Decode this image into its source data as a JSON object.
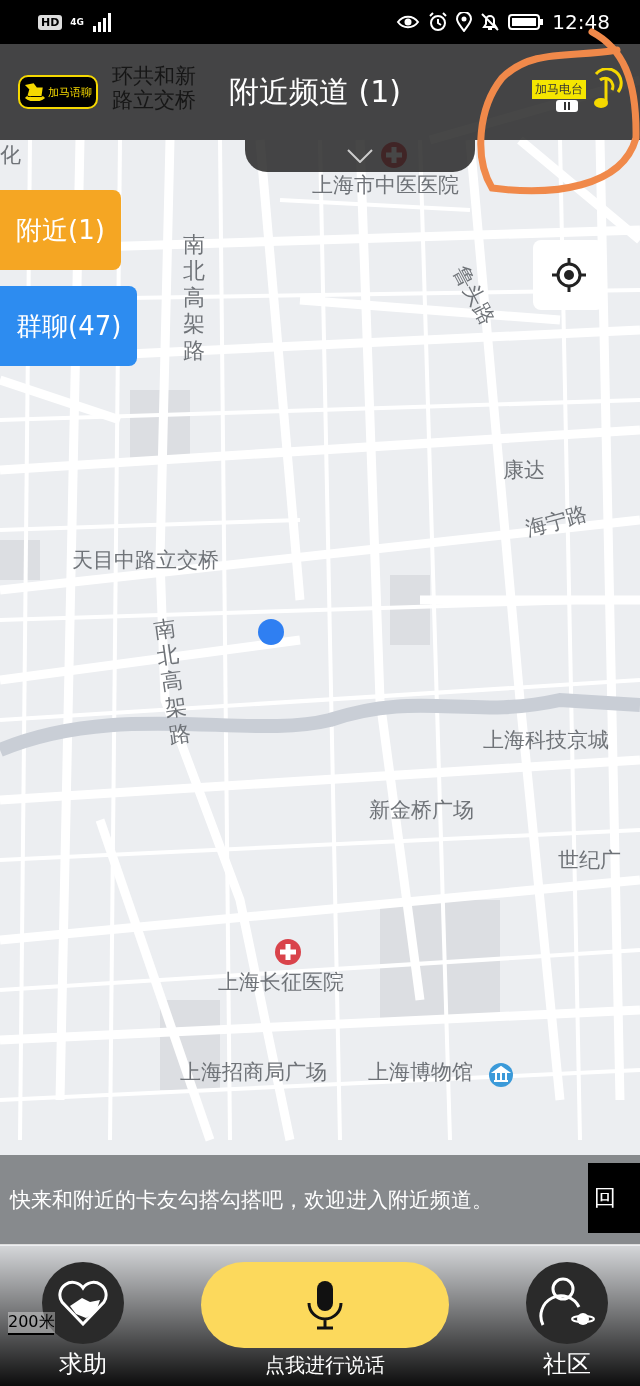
{
  "status_bar": {
    "network": "HD",
    "signal_label": "4G",
    "time": "12:48"
  },
  "header": {
    "logo_text": "加马语聊",
    "title": "附近频道 (1)",
    "radio": {
      "label": "加马电台",
      "playing": true
    }
  },
  "channel_tabs": [
    {
      "label": "附近(1)",
      "color": "#f5a623"
    },
    {
      "label": "群聊(47)",
      "color": "#2d8cf0"
    }
  ],
  "map": {
    "labels": [
      {
        "text": "环共和新路立交桥",
        "kind": "place"
      },
      {
        "text": "化",
        "kind": "place"
      },
      {
        "text": "上海市中医医院",
        "kind": "hospital"
      },
      {
        "text": "鲁头路",
        "kind": "road"
      },
      {
        "text": "南北高架路",
        "kind": "road"
      },
      {
        "text": "康达",
        "kind": "place"
      },
      {
        "text": "海宁路",
        "kind": "road"
      },
      {
        "text": "天目中路立交桥",
        "kind": "place"
      },
      {
        "text": "南北高架路",
        "kind": "road"
      },
      {
        "text": "上海科技京城",
        "kind": "place"
      },
      {
        "text": "新金桥广场",
        "kind": "place"
      },
      {
        "text": "世纪广",
        "kind": "place"
      },
      {
        "text": "上海长征医院",
        "kind": "hospital"
      },
      {
        "text": "上海招商局广场",
        "kind": "place"
      },
      {
        "text": "上海博物馆",
        "kind": "museum"
      }
    ],
    "scale": "200米"
  },
  "banner": {
    "message": "快来和附近的卡友勾搭勾搭吧，欢迎进入附近频道。",
    "side_text": "回"
  },
  "bottom_bar": {
    "help_label": "求助",
    "talk_label": "点我进行说话",
    "community_label": "社区"
  }
}
